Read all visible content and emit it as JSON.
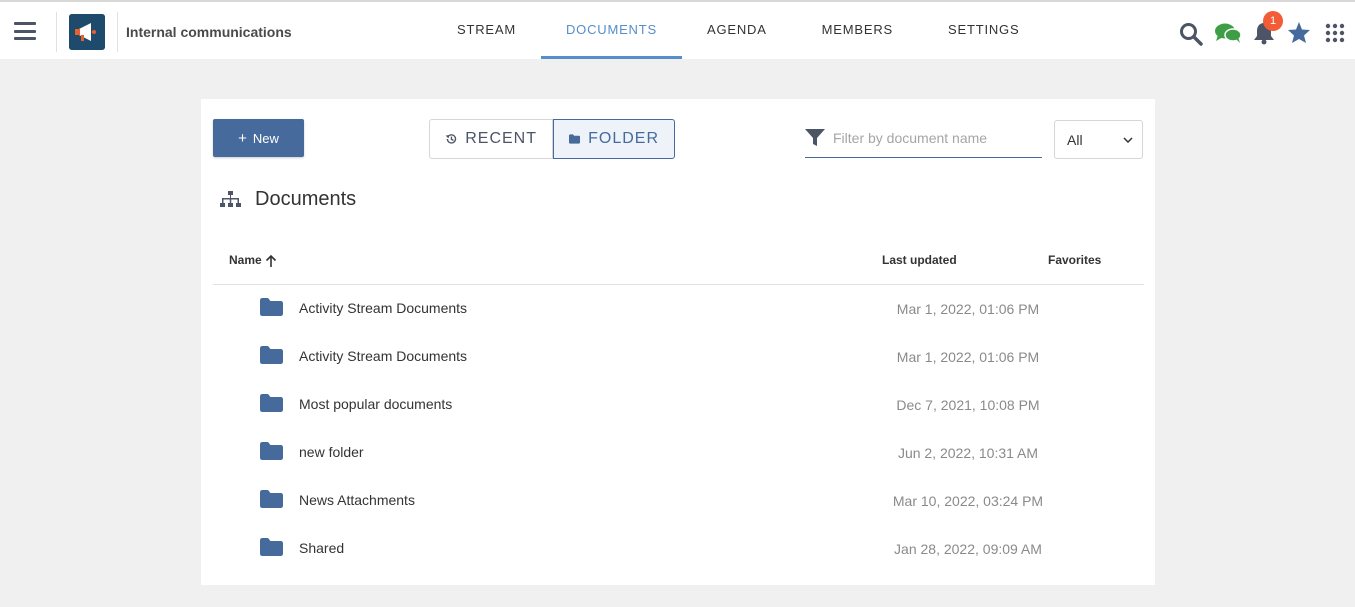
{
  "header": {
    "space_name": "Internal communications",
    "tabs": [
      {
        "label": "STREAM"
      },
      {
        "label": "DOCUMENTS"
      },
      {
        "label": "AGENDA"
      },
      {
        "label": "MEMBERS"
      },
      {
        "label": "SETTINGS"
      }
    ],
    "active_tab": "DOCUMENTS",
    "notification_count": "1",
    "icons": [
      "menu-icon",
      "search-icon",
      "chat-icon",
      "bell-icon",
      "star-icon",
      "apps-grid-icon"
    ]
  },
  "toolbar": {
    "new_label": "New",
    "recent_label": "RECENT",
    "folder_label": "FOLDER",
    "filter_placeholder": "Filter by document name",
    "select_value": "All"
  },
  "documents": {
    "title": "Documents",
    "columns": {
      "name": "Name",
      "last_updated": "Last updated",
      "favorites": "Favorites"
    },
    "rows": [
      {
        "name": "Activity Stream Documents",
        "updated": "Mar 1, 2022, 01:06 PM"
      },
      {
        "name": "Activity Stream Documents",
        "updated": "Mar 1, 2022, 01:06 PM"
      },
      {
        "name": "Most popular documents",
        "updated": "Dec 7, 2021, 10:08 PM"
      },
      {
        "name": "new folder",
        "updated": "Jun 2, 2022, 10:31 AM"
      },
      {
        "name": "News Attachments",
        "updated": "Mar 10, 2022, 03:24 PM"
      },
      {
        "name": "Shared",
        "updated": "Jan 28, 2022, 09:09 AM"
      }
    ]
  },
  "colors": {
    "accent": "#578dc9",
    "primary_button": "#476a9c",
    "folder_icon": "#476a9c",
    "badge": "#f35c37",
    "chat_icon": "#3e9e45"
  }
}
